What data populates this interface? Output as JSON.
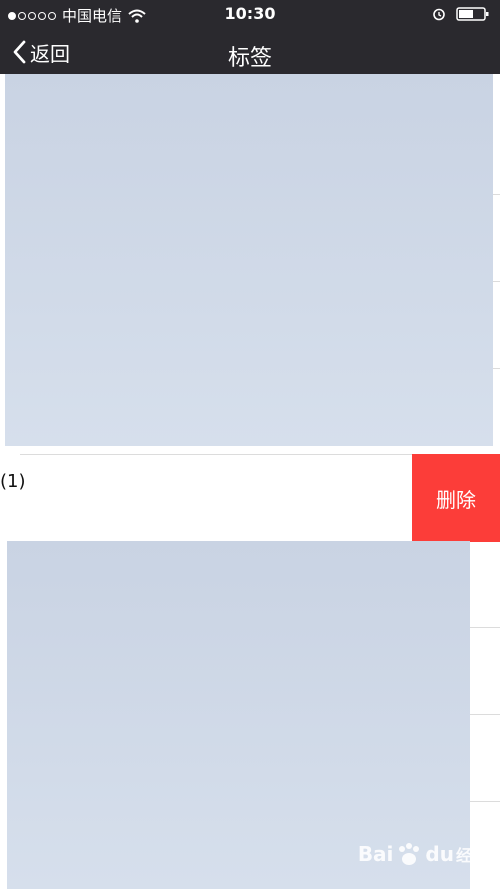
{
  "status_bar": {
    "carrier": "中国电信",
    "time": "10:30"
  },
  "nav": {
    "back_label": "返回",
    "title": "标签"
  },
  "list": {
    "row_label": "(1)",
    "delete_label": "删除"
  },
  "watermark": {
    "brand": "Bai",
    "brand_suffix": "du",
    "sub": "经验"
  },
  "colors": {
    "bar_bg": "#2a292e",
    "delete_bg": "#fc3d39",
    "placeholder": "#ccd5e6"
  }
}
